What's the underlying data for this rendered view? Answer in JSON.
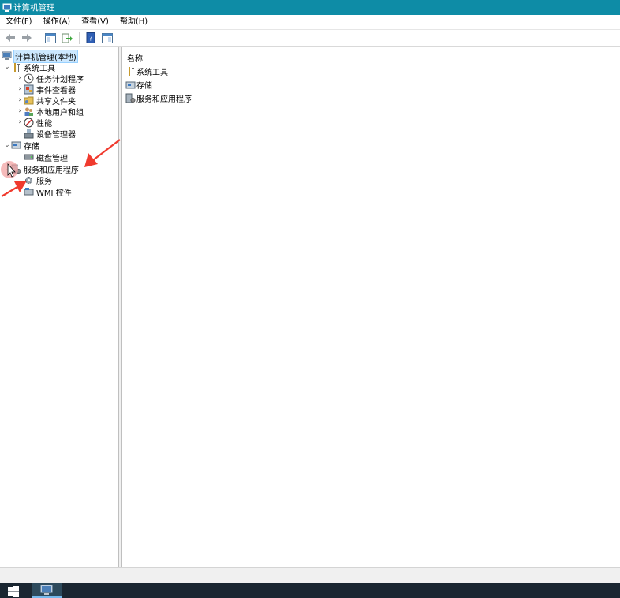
{
  "window": {
    "title": "计算机管理"
  },
  "menu": [
    {
      "label": "文件(F)"
    },
    {
      "label": "操作(A)"
    },
    {
      "label": "查看(V)"
    },
    {
      "label": "帮助(H)"
    }
  ],
  "tree": {
    "root": "计算机管理(本地)",
    "system_tools": "系统工具",
    "task_scheduler": "任务计划程序",
    "event_viewer": "事件查看器",
    "shared_folders": "共享文件夹",
    "local_users": "本地用户和组",
    "performance": "性能",
    "device_manager": "设备管理器",
    "storage": "存储",
    "disk_management": "磁盘管理",
    "services_apps": "服务和应用程序",
    "services": "服务",
    "wmi": "WMI 控件"
  },
  "list": {
    "header": "名称",
    "items": [
      "系统工具",
      "存储",
      "服务和应用程序"
    ]
  },
  "colors": {
    "titlebar": "#0e8ca6",
    "selection": "#cce8ff",
    "arrow": "#f03a2e",
    "taskbar": "#1a2631"
  }
}
